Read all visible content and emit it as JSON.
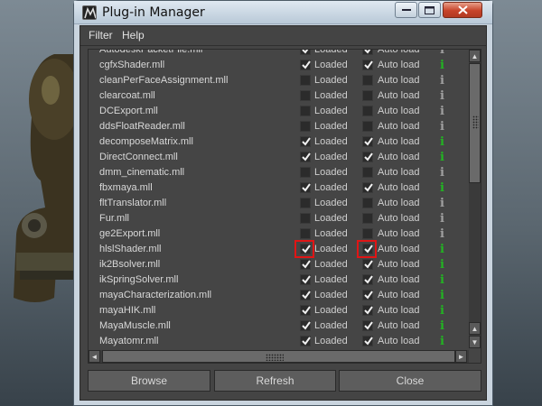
{
  "window": {
    "title": "Plug-in Manager",
    "minimize_label": "—",
    "maximize_label": "□",
    "close_label": "✕"
  },
  "menu": {
    "items": [
      "Filter",
      "Help"
    ]
  },
  "columns": {
    "loaded_label": "Loaded",
    "autoload_label": "Auto load",
    "info_icon": "i"
  },
  "plugins": [
    {
      "name": "AutodeskPacketFile.mll",
      "loaded": true,
      "autoload": true,
      "info_color": "#a0a0a0"
    },
    {
      "name": "cgfxShader.mll",
      "loaded": true,
      "autoload": true,
      "info_color": "#22b422"
    },
    {
      "name": "cleanPerFaceAssignment.mll",
      "loaded": false,
      "autoload": false,
      "info_color": "#a0a0a0"
    },
    {
      "name": "clearcoat.mll",
      "loaded": false,
      "autoload": false,
      "info_color": "#a0a0a0"
    },
    {
      "name": "DCExport.mll",
      "loaded": false,
      "autoload": false,
      "info_color": "#a0a0a0"
    },
    {
      "name": "ddsFloatReader.mll",
      "loaded": false,
      "autoload": false,
      "info_color": "#a0a0a0"
    },
    {
      "name": "decomposeMatrix.mll",
      "loaded": true,
      "autoload": true,
      "info_color": "#22b422"
    },
    {
      "name": "DirectConnect.mll",
      "loaded": true,
      "autoload": true,
      "info_color": "#22b422"
    },
    {
      "name": "dmm_cinematic.mll",
      "loaded": false,
      "autoload": false,
      "info_color": "#a0a0a0"
    },
    {
      "name": "fbxmaya.mll",
      "loaded": true,
      "autoload": true,
      "info_color": "#22b422"
    },
    {
      "name": "fltTranslator.mll",
      "loaded": false,
      "autoload": false,
      "info_color": "#a0a0a0"
    },
    {
      "name": "Fur.mll",
      "loaded": false,
      "autoload": false,
      "info_color": "#a0a0a0"
    },
    {
      "name": "ge2Export.mll",
      "loaded": false,
      "autoload": false,
      "info_color": "#a0a0a0"
    },
    {
      "name": "hlslShader.mll",
      "loaded": true,
      "autoload": true,
      "info_color": "#22b422",
      "highlight": true
    },
    {
      "name": "ik2Bsolver.mll",
      "loaded": true,
      "autoload": true,
      "info_color": "#22b422"
    },
    {
      "name": "ikSpringSolver.mll",
      "loaded": true,
      "autoload": true,
      "info_color": "#22b422"
    },
    {
      "name": "mayaCharacterization.mll",
      "loaded": true,
      "autoload": true,
      "info_color": "#22b422"
    },
    {
      "name": "mayaHIK.mll",
      "loaded": true,
      "autoload": true,
      "info_color": "#22b422"
    },
    {
      "name": "MayaMuscle.mll",
      "loaded": true,
      "autoload": true,
      "info_color": "#22b422"
    },
    {
      "name": "Mayatomr.mll",
      "loaded": true,
      "autoload": true,
      "info_color": "#22b422"
    }
  ],
  "buttons": {
    "browse": "Browse",
    "refresh": "Refresh",
    "close": "Close"
  },
  "icons": {
    "app": "maya-app-icon",
    "scroll_up": "▲",
    "scroll_down": "▼",
    "scroll_left": "◄",
    "scroll_right": "►"
  }
}
